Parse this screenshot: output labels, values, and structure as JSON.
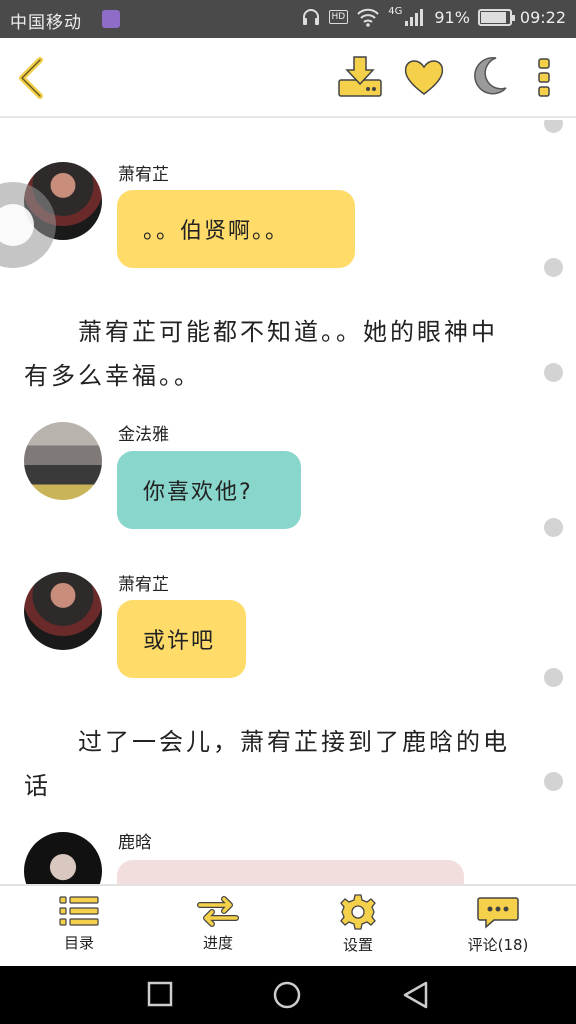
{
  "status_bar": {
    "carrier": "中国移动",
    "network": "4G",
    "hd": "HD",
    "battery_percent": "91%",
    "battery_level": 0.91,
    "time": "09:22"
  },
  "icons": {
    "back": "chevron-left-icon",
    "download": "download-icon",
    "favorite": "heart-icon",
    "night_mode": "moon-icon",
    "more": "more-vertical-icon"
  },
  "colors": {
    "accent": "#f5d04a",
    "bubble_yellow": "#ffdc6a",
    "bubble_teal": "#88d6cc",
    "bubble_pink": "#f3dede",
    "statusbar": "#4a4a4a"
  },
  "messages": [
    {
      "type": "chat",
      "name": "萧宥芷",
      "text": "。。伯贤啊。。"
    },
    {
      "type": "narration",
      "text": "萧宥芷可能都不知道。。她的眼神中有多么幸福。。"
    },
    {
      "type": "chat",
      "name": "金法雅",
      "text": "你喜欢他?"
    },
    {
      "type": "chat",
      "name": "萧宥芷",
      "text": "或许吧"
    },
    {
      "type": "narration",
      "text": "过了一会儿，萧宥芷接到了鹿晗的电话"
    },
    {
      "type": "chat",
      "name": "鹿晗",
      "text": ""
    }
  ],
  "bottom_tabs": [
    {
      "label": "目录",
      "icon": "list-icon"
    },
    {
      "label": "进度",
      "icon": "transfer-arrows-icon"
    },
    {
      "label": "设置",
      "icon": "gear-icon"
    },
    {
      "label": "评论(18)",
      "icon": "comment-bubble-icon"
    }
  ]
}
